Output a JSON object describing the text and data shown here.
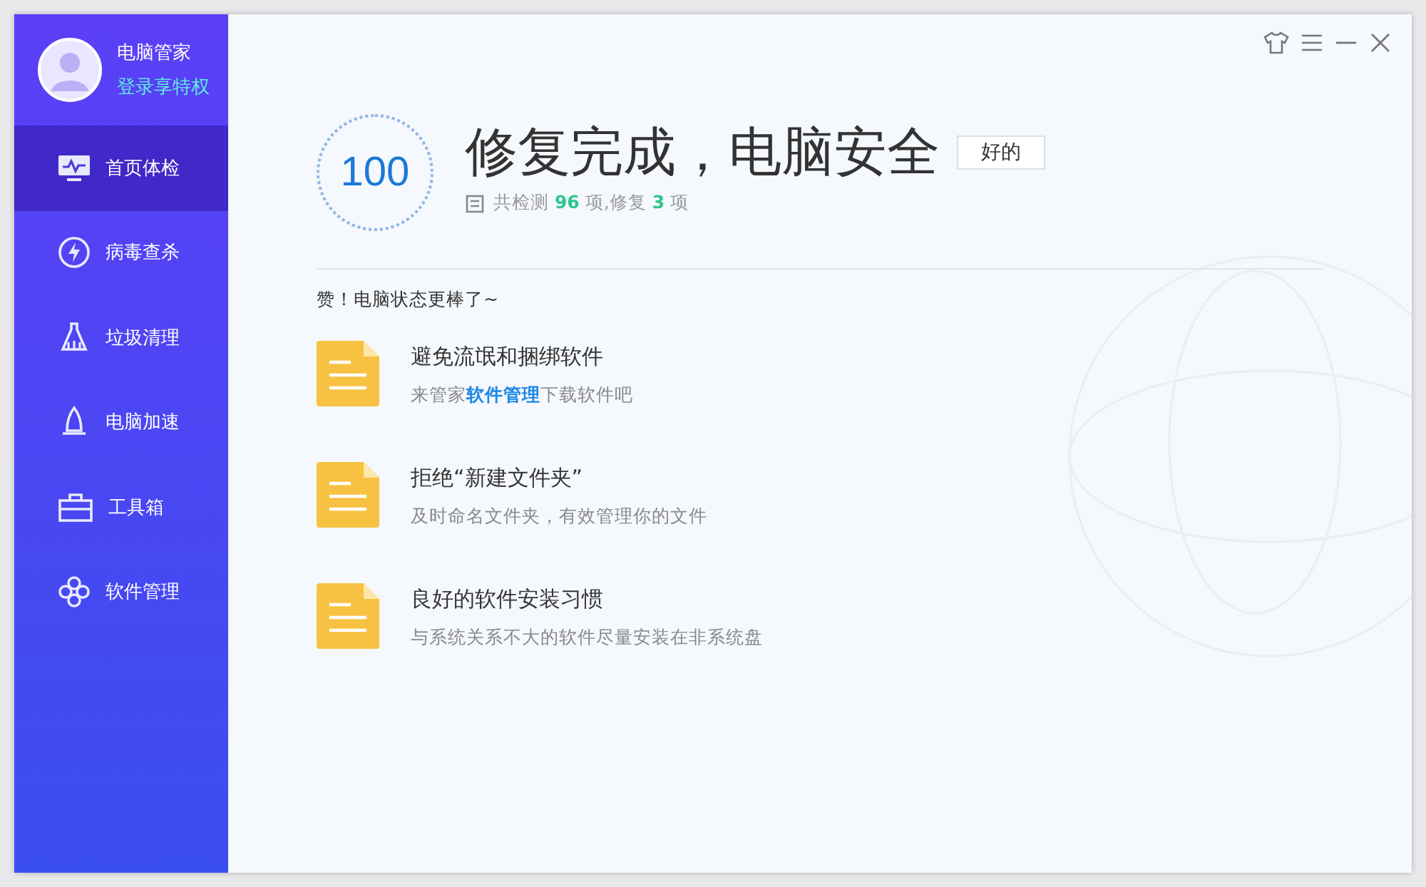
{
  "user": {
    "name": "电脑管家",
    "login": "登录享特权"
  },
  "nav": [
    {
      "label": "首页体检",
      "selected": true
    },
    {
      "label": "病毒查杀",
      "selected": false
    },
    {
      "label": "垃圾清理",
      "selected": false
    },
    {
      "label": "电脑加速",
      "selected": false
    },
    {
      "label": "工具箱",
      "selected": false
    },
    {
      "label": "软件管理",
      "selected": false
    }
  ],
  "result": {
    "score": "100",
    "title": "修复完成，电脑安全",
    "button": "好的",
    "summary": "共检测 **96** 项,修复 **3** 项"
  },
  "praise": "赞！电脑状态更棒了~",
  "tips": [
    {
      "title": "避免流氓和捆绑软件",
      "description": [
        {
          "kind": "plain",
          "text": "来管家"
        },
        {
          "kind": "link",
          "text": "软件管理"
        },
        {
          "kind": "plain",
          "text": "下载软件吧"
        }
      ]
    },
    {
      "title": "拒绝“新建文件夹”",
      "description": [
        {
          "kind": "plain",
          "text": "及时命名文件夹，有效管理你的文件"
        }
      ]
    },
    {
      "title": "良好的软件安装习惯",
      "description": [
        {
          "kind": "plain",
          "text": "与系统关系不大的软件尽量安装在非系统盘"
        }
      ]
    }
  ]
}
